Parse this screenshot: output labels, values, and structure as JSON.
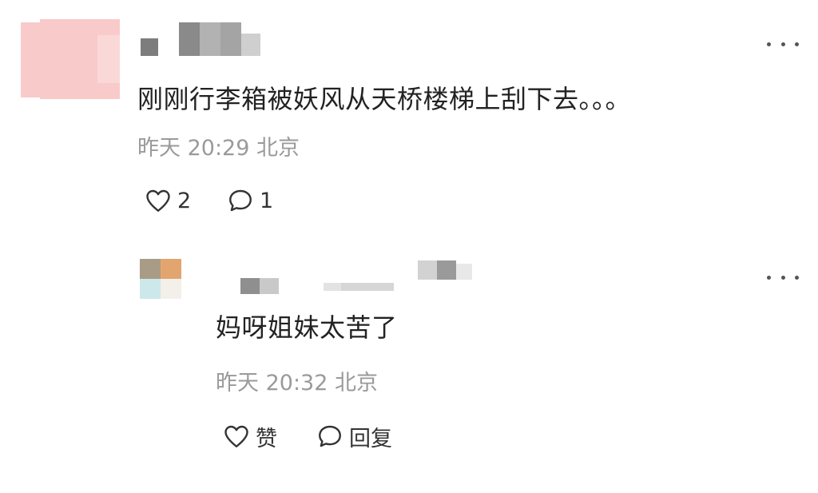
{
  "comments": [
    {
      "text": "刚刚行李箱被妖风从天桥楼梯上刮下去。。。",
      "time": "昨天 20:29",
      "location": "北京",
      "likes": "2",
      "replies": "1",
      "like_icon": "heart-outline-icon",
      "reply_icon": "speech-bubble-icon",
      "more_icon": "more-dots-icon"
    },
    {
      "text": "妈呀姐妹太苦了",
      "time": "昨天 20:32",
      "location": "北京",
      "like_label": "赞",
      "reply_label": "回复",
      "like_icon": "heart-outline-icon",
      "reply_icon": "speech-bubble-icon",
      "more_icon": "more-dots-icon"
    }
  ],
  "colors": {
    "text": "#222222",
    "meta": "#9a9a9a",
    "avatar1": "#f9c9c9",
    "avatar2_tl": "#a89c86",
    "avatar2_tr": "#e2a570",
    "avatar2_bl": "#cde8ea"
  }
}
